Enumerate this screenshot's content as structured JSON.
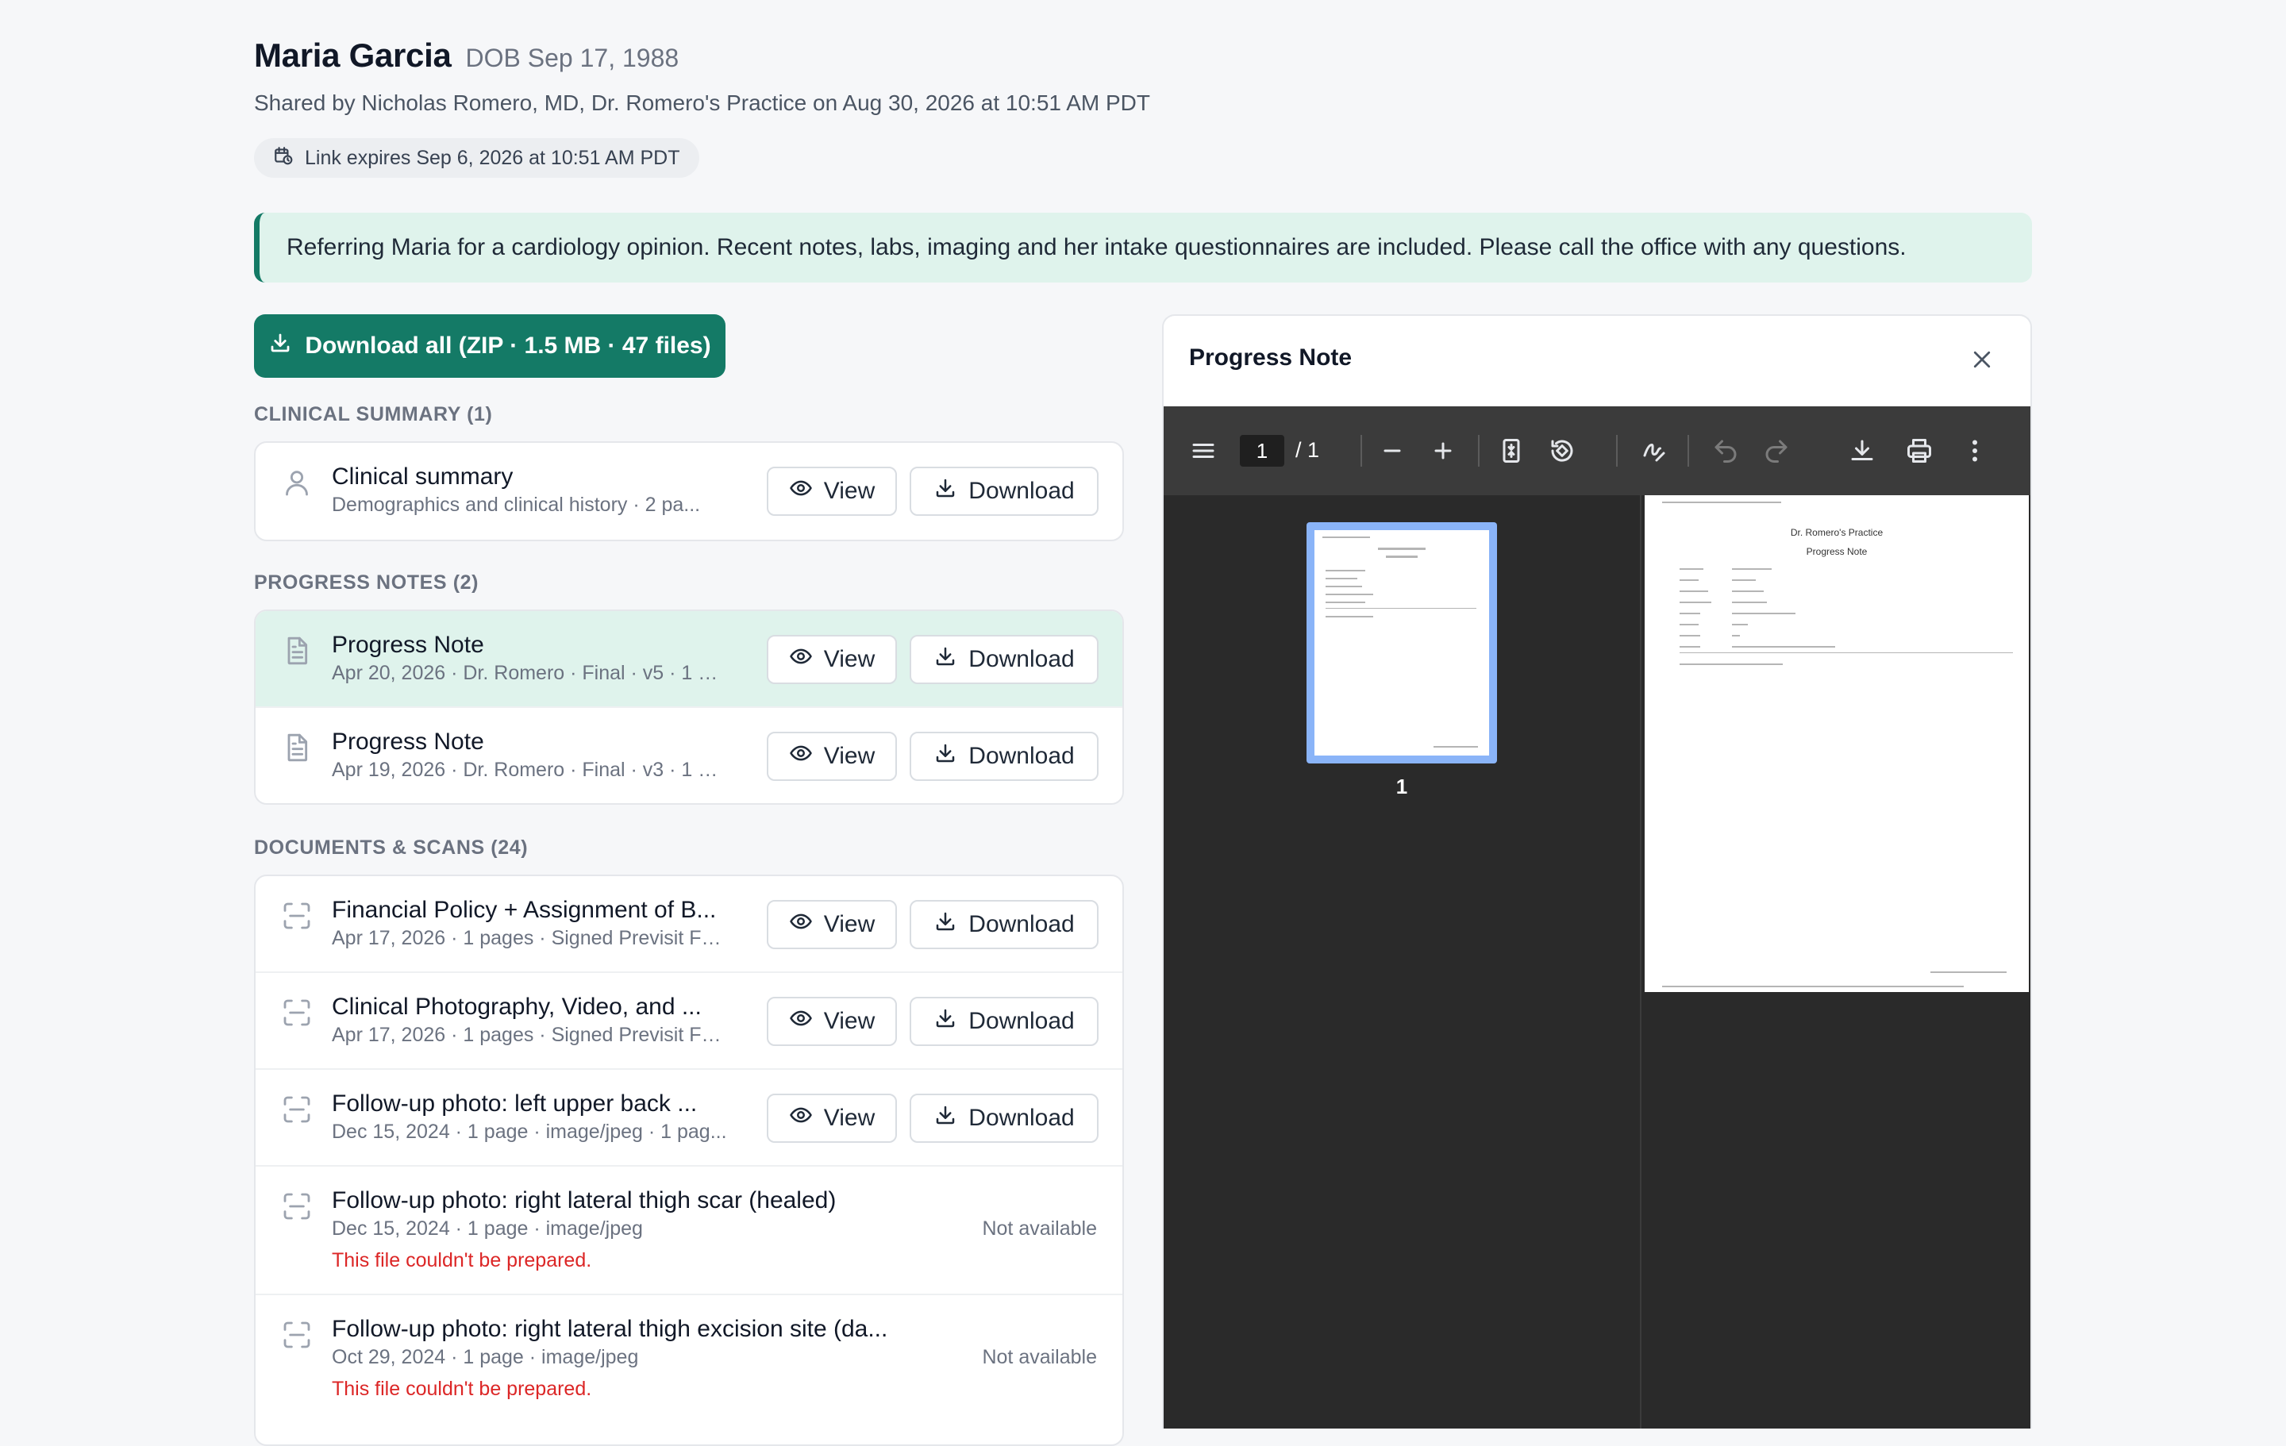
{
  "header": {
    "patient_name": "Maria Garcia",
    "dob": "DOB Sep 17, 1988",
    "shared_by": "Shared by Nicholas Romero, MD, Dr. Romero's Practice on Aug 30, 2026 at 10:51 AM PDT",
    "link_expires": "Link expires Sep 6, 2026 at 10:51 AM PDT"
  },
  "message": "Referring Maria for a cardiology opinion. Recent notes, labs, imaging and her intake questionnaires are included. Please call the office with any questions.",
  "download_all_label": "Download all (ZIP · 1.5 MB · 47 files)",
  "actions": {
    "view": "View",
    "download": "Download",
    "not_available": "Not available"
  },
  "sections": {
    "clinical_summary": {
      "heading": "CLINICAL SUMMARY (1)",
      "items": [
        {
          "title": "Clinical summary",
          "subtitle": "Demographics and clinical history · 2 pa..."
        }
      ]
    },
    "progress_notes": {
      "heading": "PROGRESS NOTES (2)",
      "items": [
        {
          "title": "Progress Note",
          "subtitle": "Apr 20, 2026 · Dr. Romero · Final · v5 · 1 pa..."
        },
        {
          "title": "Progress Note",
          "subtitle": "Apr 19, 2026 · Dr. Romero · Final · v3 · 1 pa..."
        }
      ]
    },
    "documents": {
      "heading": "DOCUMENTS & SCANS (24)",
      "items": [
        {
          "title": "Financial Policy + Assignment of B...",
          "subtitle": "Apr 17, 2026 · 1 pages · Signed Previsit For..."
        },
        {
          "title": "Clinical Photography, Video, and ...",
          "subtitle": "Apr 17, 2026 · 1 pages · Signed Previsit For..."
        },
        {
          "title": "Follow-up photo: left upper back ...",
          "subtitle": "Dec 15, 2024 · 1 page · image/jpeg · 1 pag..."
        },
        {
          "title": "Follow-up photo: right lateral thigh scar (healed)",
          "subtitle": "Dec 15, 2024 · 1 page · image/jpeg",
          "error": "This file couldn't be prepared."
        },
        {
          "title": "Follow-up photo: right lateral thigh excision site (da...",
          "subtitle": "Oct 29, 2024 · 1 page · image/jpeg",
          "error": "This file couldn't be prepared."
        }
      ]
    }
  },
  "viewer": {
    "title": "Progress Note",
    "current_page": "1",
    "total_pages": "/ 1",
    "thumb_label": "1",
    "doc_practice": "Dr. Romero's Practice",
    "doc_title": "Progress Note"
  }
}
